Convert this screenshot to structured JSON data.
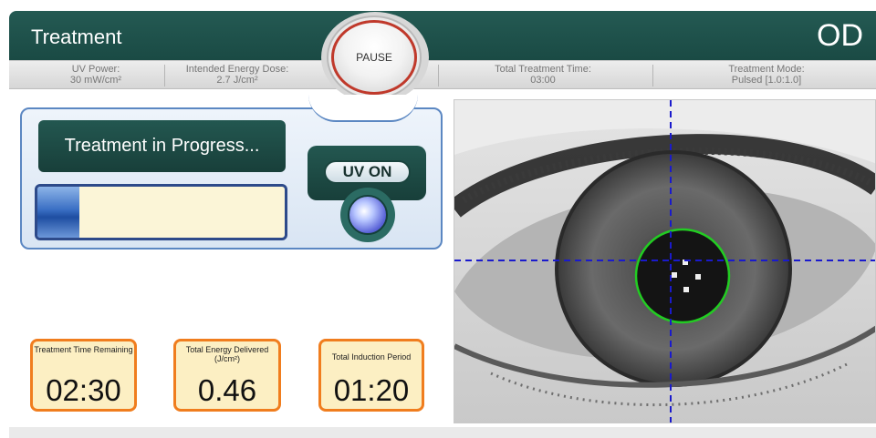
{
  "header": {
    "title": "Treatment",
    "eye": "OD",
    "pause_label": "PAUSE"
  },
  "info_bar": {
    "uv_power_label": "UV Power:",
    "uv_power_value": "30 mW/cm²",
    "energy_dose_label": "Intended Energy Dose:",
    "energy_dose_value": "2.7 J/cm²",
    "total_time_label": "Total Treatment Time:",
    "total_time_value": "03:00",
    "mode_label": "Treatment Mode:",
    "mode_value": "Pulsed [1.0:1.0]"
  },
  "status": {
    "label": "Treatment in Progress...",
    "progress_fraction": 0.17,
    "uv_label": "UV ON"
  },
  "metrics": {
    "time_remaining_label": "Treatment Time Remaining",
    "time_remaining_value": "02:30",
    "energy_delivered_label": "Total Energy Delivered (J/cm²)",
    "energy_delivered_value": "0.46",
    "induction_label": "Total Induction Period",
    "induction_value": "01:20"
  },
  "colors": {
    "header": "#1f4f49",
    "accent_orange": "#f07d1e",
    "crosshair": "#1a1acc",
    "alignment_ring": "#22cc22",
    "pause_ring": "#c0392b"
  },
  "icons": {
    "uv_lamp": "uv-lamp-icon",
    "eye_crosshair": "crosshair-icon"
  }
}
